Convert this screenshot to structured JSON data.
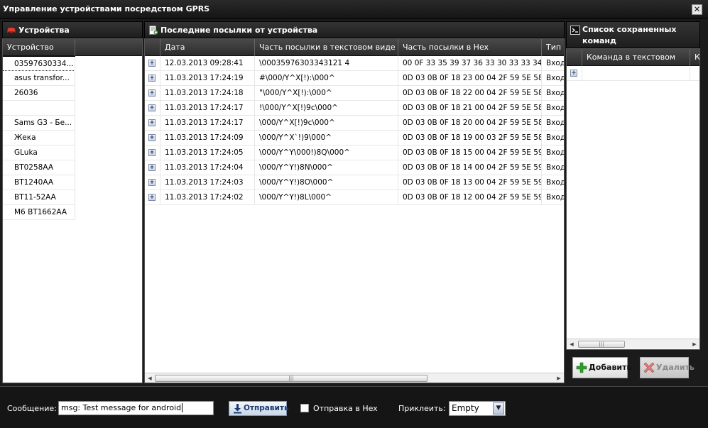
{
  "window": {
    "title": "Управление устройствами посредством GPRS",
    "close_label": "✕"
  },
  "devices": {
    "title": "Устройства",
    "column_header": "Устройство",
    "items": [
      "03597630334...",
      "asus transfor...",
      "26036",
      "",
      "Sams G3 - Бе...",
      "Жека",
      "GLuka",
      "BT0258AA",
      "BT1240AA",
      "BT11-52AA",
      "M6 BT1662AA"
    ]
  },
  "packets": {
    "title": "Последние посылки от устройства",
    "columns": [
      "Дата",
      "Часть посылки в текстовом виде",
      "Часть посылки в Hex",
      "Тип"
    ],
    "rows": [
      {
        "date": "12.03.2013 09:28:41",
        "text": "\\00035976303343121 4",
        "hex": "00 0F 33 35 39 37 36 33 30 33 33 34 ...",
        "type": "Входя"
      },
      {
        "date": "11.03.2013 17:24:19",
        "text": "#\\000/Y^X[!):\\000^",
        "hex": "0D 03 0B 0F 18 23 00 04 2F 59 5E 58...",
        "type": "Входя"
      },
      {
        "date": "11.03.2013 17:24:18",
        "text": "\"\\000/Y^X[!):\\000^",
        "hex": "0D 03 0B 0F 18 22 00 04 2F 59 5E 58...",
        "type": "Входя"
      },
      {
        "date": "11.03.2013 17:24:17",
        "text": "!\\000/Y^X[!)9c\\000^",
        "hex": "0D 03 0B 0F 18 21 00 04 2F 59 5E 58...",
        "type": "Входя"
      },
      {
        "date": "11.03.2013 17:24:17",
        "text": " \\000/Y^X[!)9c\\000^",
        "hex": "0D 03 0B 0F 18 20 00 04 2F 59 5E 58...",
        "type": "Входя"
      },
      {
        "date": "11.03.2013 17:24:09",
        "text": "\\000/Y^X`!)9\\000^",
        "hex": "0D 03 0B 0F 18 19 00 03 2F 59 5E 58...",
        "type": "Входя"
      },
      {
        "date": "11.03.2013 17:24:05",
        "text": "\\000/Y^Y\\000!)8Q\\000^",
        "hex": "0D 03 0B 0F 18 15 00 04 2F 59 5E 59...",
        "type": "Входя"
      },
      {
        "date": "11.03.2013 17:24:04",
        "text": "\\000/Y^Y!)8N\\000^",
        "hex": "0D 03 0B 0F 18 14 00 04 2F 59 5E 59...",
        "type": "Входя"
      },
      {
        "date": "11.03.2013 17:24:03",
        "text": "\\000/Y^Y!)8O\\000^",
        "hex": "0D 03 0B 0F 18 13 00 04 2F 59 5E 59...",
        "type": "Входя"
      },
      {
        "date": "11.03.2013 17:24:02",
        "text": "\\000/Y^Y!)8L\\000^",
        "hex": "0D 03 0B 0F 18 12 00 04 2F 59 5E 59...",
        "type": "Входя"
      }
    ]
  },
  "commands": {
    "title": "Список сохраненных команд",
    "columns": [
      "Команда в текстовом",
      "К"
    ],
    "add_label": "Добавить",
    "delete_label": "Удалить"
  },
  "bottom": {
    "message_label": "Сообщение:",
    "message_value": "msg: Test message for android",
    "send_label": "Отправить",
    "hex_label": "Отправка в Hex",
    "attach_label": "Приклеить:",
    "attach_value": "Empty"
  },
  "colors": {
    "accent_blue": "#1b3a6e",
    "background": "#1b1b1b",
    "add_green": "#2e9e2e",
    "delete_red": "#d23a3a"
  }
}
